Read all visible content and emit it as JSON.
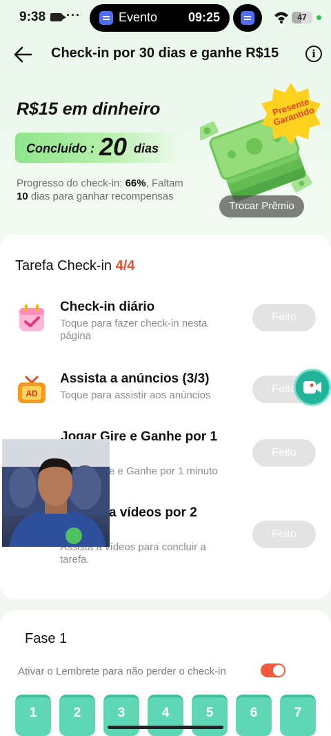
{
  "status_bar": {
    "time": "9:38",
    "dots": "···",
    "island_label": "Evento",
    "island_time": "09:25",
    "battery": "47"
  },
  "header": {
    "title": "Check-in por 30 dias e ganhe R$15",
    "info": "i"
  },
  "hero": {
    "reward_title": "R$15 em dinheiro",
    "concluded_prefix": "Concluído :",
    "concluded_days": "20",
    "concluded_unit": "dias",
    "progress_prefix": "Progresso do check-in: ",
    "progress_pct": "66%",
    "progress_mid": ", Faltam ",
    "days_left": "10",
    "progress_suffix": " dias para ganhar recompensas",
    "badge_line1": "Presente",
    "badge_line2": "Garantido",
    "trocar_label": "Trocar Prêmio"
  },
  "tasks": {
    "title": "Tarefa Check-in",
    "count": "4/4",
    "items": [
      {
        "name": "Check-in diário",
        "desc": "Toque para fazer check-in nesta página",
        "button": "Feito"
      },
      {
        "name": "Assista a anúncios  (3/3)",
        "desc": "Toque para assistir aos anúncios",
        "button": "Feito"
      },
      {
        "name": "Jogar Gire e Ganhe por 1",
        "desc": "e e Ganhe por 1 minuto",
        "button": "Feito"
      },
      {
        "name": "a vídeos por 2",
        "desc": "Assista a vídeos para concluir a tarefa.",
        "button": "Feito"
      }
    ]
  },
  "fase": {
    "title": "Fase 1",
    "reminder": "Ativar o Lembrete para não perder o check-in",
    "reminder_on": true,
    "days": [
      "1",
      "2",
      "3",
      "4",
      "5",
      "6",
      "7"
    ]
  },
  "colors": {
    "accent_green": "#5fd7b5",
    "count_red": "#e5502e",
    "toggle_on": "#ef5b3c",
    "fab": "#22b39a"
  }
}
